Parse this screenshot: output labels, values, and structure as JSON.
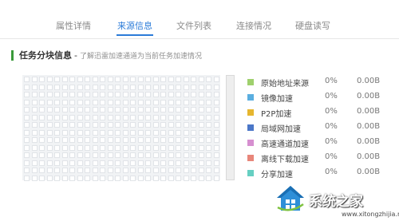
{
  "tabs": [
    {
      "label": "属性详情"
    },
    {
      "label": "来源信息"
    },
    {
      "label": "文件列表"
    },
    {
      "label": "连接情况"
    },
    {
      "label": "硬盘读写"
    }
  ],
  "active_tab": "来源信息",
  "section": {
    "title": "任务分块信息",
    "dash": "-",
    "subtitle": "了解迅雷加速通道为当前任务加速情况"
  },
  "legend": [
    {
      "label": "原始地址来源",
      "percent": "0%",
      "size": "0.00B",
      "color": "#9fd06d"
    },
    {
      "label": "镜像加速",
      "percent": "0%",
      "size": "0.00B",
      "color": "#5aaee0"
    },
    {
      "label": "P2P加速",
      "percent": "0%",
      "size": "0.00B",
      "color": "#e6b62f"
    },
    {
      "label": "局域网加速",
      "percent": "0%",
      "size": "0.00B",
      "color": "#4b77c8"
    },
    {
      "label": "高速通道加速",
      "percent": "0%",
      "size": "0.00B",
      "color": "#d68fd0"
    },
    {
      "label": "离线下载加速",
      "percent": "0%",
      "size": "0.00B",
      "color": "#e8867a"
    },
    {
      "label": "分享加速",
      "percent": "0%",
      "size": "0.00B",
      "color": "#66cfc2"
    }
  ],
  "watermark": {
    "name": "系统之家",
    "url": "www.xitongzhijia.net"
  },
  "colors": {
    "accent": "#2b7bd8",
    "title_mark": "#3a9a3a"
  }
}
